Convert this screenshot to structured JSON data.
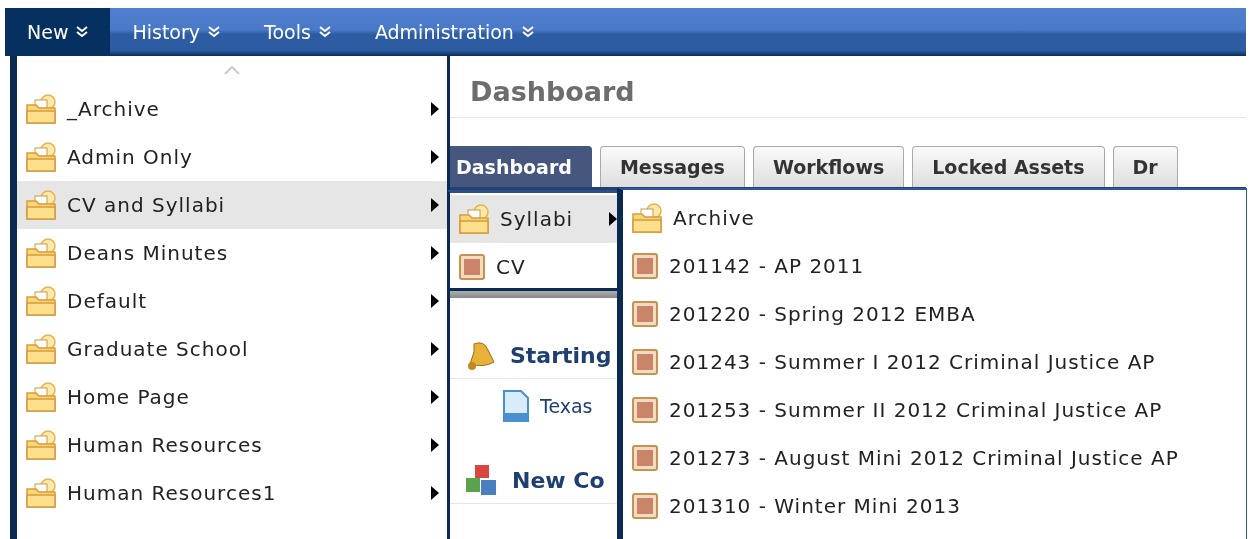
{
  "menubar": {
    "items": [
      {
        "label": "New",
        "selected": true
      },
      {
        "label": "History",
        "selected": false
      },
      {
        "label": "Tools",
        "selected": false
      },
      {
        "label": "Administration",
        "selected": false
      }
    ]
  },
  "page": {
    "heading": "Dashboard",
    "tabs": [
      {
        "label": "Dashboard",
        "selected": true
      },
      {
        "label": "Messages",
        "selected": false
      },
      {
        "label": "Workflows",
        "selected": false
      },
      {
        "label": "Locked Assets",
        "selected": false
      },
      {
        "label": "Dr",
        "selected": false
      }
    ],
    "sections": [
      {
        "title": "Starting",
        "kind": "bell",
        "items": [
          "Texas"
        ]
      },
      {
        "title": "New Co",
        "kind": "cubes"
      }
    ]
  },
  "menus": [
    {
      "scroll_up": true,
      "items": [
        {
          "label": "_Archive",
          "kind": "folder",
          "has_submenu": true,
          "selected": false
        },
        {
          "label": "Admin Only",
          "kind": "folder",
          "has_submenu": true,
          "selected": false
        },
        {
          "label": "CV and Syllabi",
          "kind": "folder",
          "has_submenu": true,
          "selected": true
        },
        {
          "label": "Deans Minutes",
          "kind": "folder",
          "has_submenu": true,
          "selected": false
        },
        {
          "label": "Default",
          "kind": "folder",
          "has_submenu": true,
          "selected": false
        },
        {
          "label": "Graduate School",
          "kind": "folder",
          "has_submenu": true,
          "selected": false
        },
        {
          "label": "Home Page",
          "kind": "folder",
          "has_submenu": true,
          "selected": false
        },
        {
          "label": "Human Resources",
          "kind": "folder",
          "has_submenu": true,
          "selected": false
        },
        {
          "label": "Human Resources1",
          "kind": "folder",
          "has_submenu": true,
          "selected": false
        }
      ]
    },
    {
      "scroll_up": false,
      "items": [
        {
          "label": "Syllabi",
          "kind": "folder",
          "has_submenu": true,
          "selected": true
        },
        {
          "label": "CV",
          "kind": "page",
          "has_submenu": false,
          "selected": false
        }
      ]
    },
    {
      "scroll_up": false,
      "items": [
        {
          "label": "Archive",
          "kind": "folder",
          "has_submenu": false,
          "selected": false
        },
        {
          "label": "201142 - AP 2011",
          "kind": "page",
          "has_submenu": false,
          "selected": false
        },
        {
          "label": "201220 - Spring 2012 EMBA",
          "kind": "page",
          "has_submenu": false,
          "selected": false
        },
        {
          "label": "201243 - Summer I 2012 Criminal Justice AP",
          "kind": "page",
          "has_submenu": false,
          "selected": false
        },
        {
          "label": "201253 - Summer II 2012 Criminal Justice AP",
          "kind": "page",
          "has_submenu": false,
          "selected": false
        },
        {
          "label": "201273 - August Mini 2012 Criminal Justice AP",
          "kind": "page",
          "has_submenu": false,
          "selected": false
        },
        {
          "label": "201310 - Winter Mini 2013",
          "kind": "page",
          "has_submenu": false,
          "selected": false
        }
      ]
    }
  ]
}
